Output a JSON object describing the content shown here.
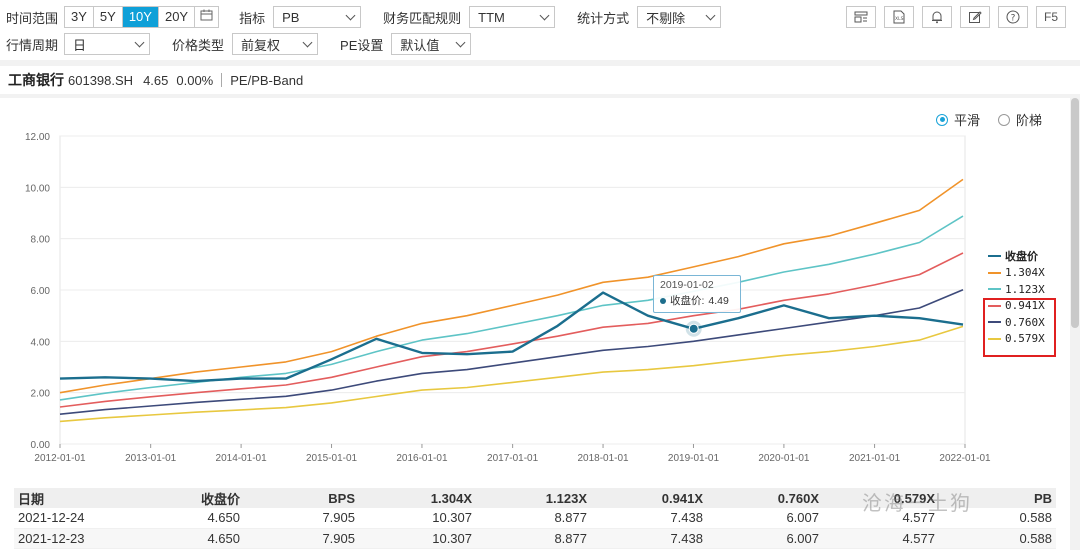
{
  "toolbar": {
    "time_range_label": "时间范围",
    "time_range_options": [
      "3Y",
      "5Y",
      "10Y",
      "20Y"
    ],
    "time_range_active": "10Y",
    "indicator_label": "指标",
    "indicator_value": "PB",
    "finance_rule_label": "财务匹配规则",
    "finance_rule_value": "TTM",
    "stat_method_label": "统计方式",
    "stat_method_value": "不剔除",
    "period_label": "行情周期",
    "period_value": "日",
    "price_type_label": "价格类型",
    "price_type_value": "前复权",
    "pe_setting_label": "PE设置",
    "pe_setting_value": "默认值",
    "icons": [
      "layout-icon",
      "xls-icon",
      "bell-icon",
      "edit-icon",
      "help-icon",
      "F5"
    ]
  },
  "stock": {
    "name": "工商银行",
    "code": "601398.SH",
    "price": "4.65",
    "change": "0.00%",
    "view": "PE/PB-Band"
  },
  "mode": {
    "smooth": "平滑",
    "step": "阶梯",
    "selected": "平滑"
  },
  "tooltip": {
    "date": "2019-01-02",
    "label": "收盘价:",
    "value": "4.49"
  },
  "chart_data": {
    "type": "line",
    "x_ticks": [
      "2012-01-01",
      "2013-01-01",
      "2014-01-01",
      "2015-01-01",
      "2016-01-01",
      "2017-01-01",
      "2018-01-01",
      "2019-01-01",
      "2020-01-01",
      "2021-01-01",
      "2022-01-01"
    ],
    "y_ticks": [
      "0.00",
      "2.00",
      "4.00",
      "6.00",
      "8.00",
      "10.00",
      "12.00"
    ],
    "ylim": [
      0,
      12
    ],
    "xlim": [
      "2012-01-01",
      "2022-01-01"
    ],
    "grid": "horizontal",
    "legend_position": "right",
    "x": [
      "2012-01-01",
      "2012-07-01",
      "2013-01-01",
      "2013-07-01",
      "2014-01-01",
      "2014-07-01",
      "2015-01-01",
      "2015-07-01",
      "2016-01-01",
      "2016-07-01",
      "2017-01-01",
      "2017-07-01",
      "2018-01-01",
      "2018-07-01",
      "2019-01-01",
      "2019-07-01",
      "2020-01-01",
      "2020-07-01",
      "2021-01-01",
      "2021-07-01",
      "2021-12-24"
    ],
    "series": [
      {
        "name": "收盘价",
        "color": "#1b6e8e",
        "values": [
          2.55,
          2.6,
          2.55,
          2.45,
          2.55,
          2.55,
          3.3,
          4.1,
          3.55,
          3.5,
          3.6,
          4.6,
          5.9,
          5.0,
          4.49,
          4.9,
          5.4,
          4.9,
          5.0,
          4.9,
          4.65
        ]
      },
      {
        "name": "1.304X",
        "color": "#f0932a",
        "values": [
          2.0,
          2.3,
          2.55,
          2.8,
          3.0,
          3.2,
          3.6,
          4.2,
          4.7,
          5.0,
          5.4,
          5.8,
          6.3,
          6.5,
          6.9,
          7.3,
          7.8,
          8.1,
          8.6,
          9.1,
          10.31
        ]
      },
      {
        "name": "1.123X",
        "color": "#5ec4c6",
        "values": [
          1.72,
          1.98,
          2.2,
          2.4,
          2.6,
          2.75,
          3.1,
          3.6,
          4.05,
          4.3,
          4.65,
          5.0,
          5.4,
          5.6,
          5.95,
          6.3,
          6.7,
          7.0,
          7.4,
          7.85,
          8.88
        ]
      },
      {
        "name": "0.941X",
        "color": "#e35d5d",
        "values": [
          1.44,
          1.66,
          1.84,
          2.0,
          2.15,
          2.3,
          2.6,
          3.0,
          3.4,
          3.6,
          3.9,
          4.2,
          4.55,
          4.7,
          5.0,
          5.25,
          5.6,
          5.85,
          6.2,
          6.6,
          7.44
        ]
      },
      {
        "name": "0.760X",
        "color": "#3d4a7a",
        "values": [
          1.16,
          1.34,
          1.48,
          1.62,
          1.74,
          1.86,
          2.1,
          2.45,
          2.75,
          2.9,
          3.15,
          3.4,
          3.65,
          3.8,
          4.0,
          4.25,
          4.5,
          4.75,
          5.0,
          5.3,
          6.01
        ]
      },
      {
        "name": "0.579X",
        "color": "#e8c840",
        "values": [
          0.88,
          1.02,
          1.13,
          1.24,
          1.33,
          1.42,
          1.6,
          1.85,
          2.1,
          2.2,
          2.4,
          2.6,
          2.8,
          2.9,
          3.05,
          3.25,
          3.45,
          3.6,
          3.8,
          4.05,
          4.58
        ]
      }
    ]
  },
  "table": {
    "headers": [
      "日期",
      "收盘价",
      "BPS",
      "1.304X",
      "1.123X",
      "0.941X",
      "0.760X",
      "0.579X",
      "PB"
    ],
    "rows": [
      [
        "2021-12-24",
        "4.650",
        "7.905",
        "10.307",
        "8.877",
        "7.438",
        "6.007",
        "4.577",
        "0.588"
      ],
      [
        "2021-12-23",
        "4.650",
        "7.905",
        "10.307",
        "8.877",
        "7.438",
        "6.007",
        "4.577",
        "0.588"
      ]
    ]
  },
  "watermark": "沧海一土狗"
}
